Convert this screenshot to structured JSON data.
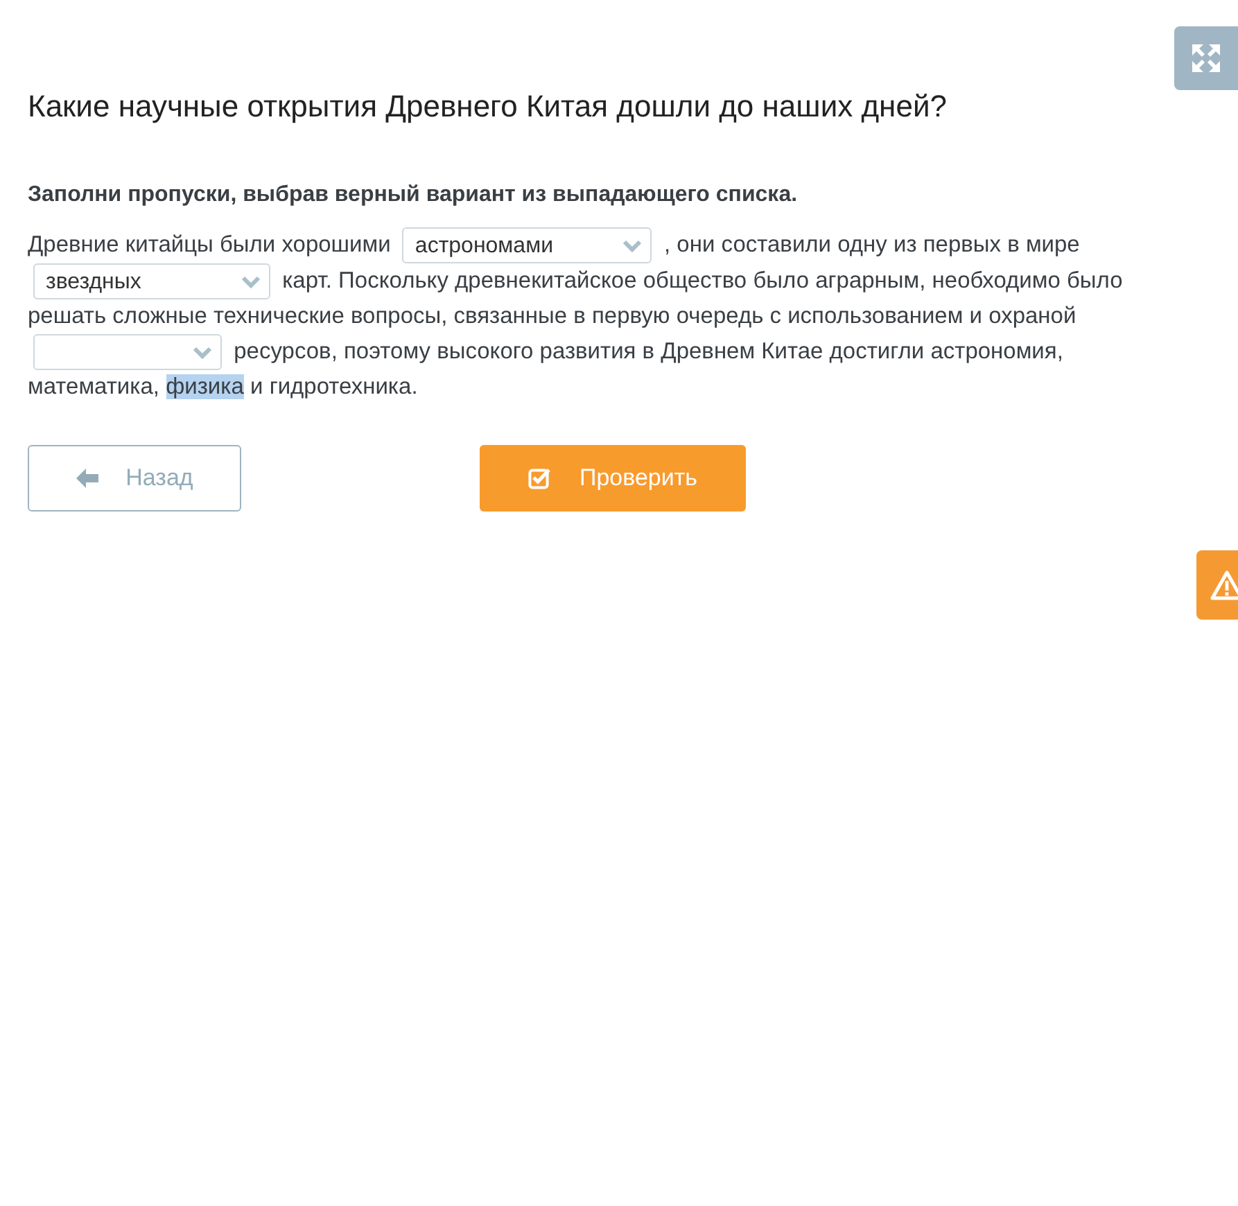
{
  "title": "Какие научные открытия Древнего Китая дошли до наших дней?",
  "instruction": "Заполни пропуски, выбрав верный вариант из выпадающего списка.",
  "passage": [
    {
      "kind": "text",
      "text": "Древние китайцы были хорошими"
    },
    {
      "kind": "dropdown",
      "value": "астрономами"
    },
    {
      "kind": "text",
      "text": ", они составили одну из первых в мире"
    },
    {
      "kind": "dropdown",
      "value": "звездных"
    },
    {
      "kind": "text",
      "text": "карт. Поскольку древнекитайское общество было аграрным, необходимо было"
    },
    {
      "kind": "text",
      "text": "решать сложные технические вопросы, связанные в первую очередь с использованием и охраной"
    },
    {
      "kind": "dropdown"
    },
    {
      "kind": "text",
      "text": "ресурсов, поэтому высокого развития в Древнем Китае достигли астрономия,"
    },
    {
      "kind": "text",
      "text": "математика,"
    },
    {
      "kind": "text",
      "text": "физика",
      "highlighted": true
    },
    {
      "kind": "text",
      "text": "и гидротехника."
    }
  ],
  "buttons": [
    {
      "kind": "back",
      "label": "Назад"
    },
    {
      "kind": "check",
      "label": "Проверить"
    }
  ]
}
